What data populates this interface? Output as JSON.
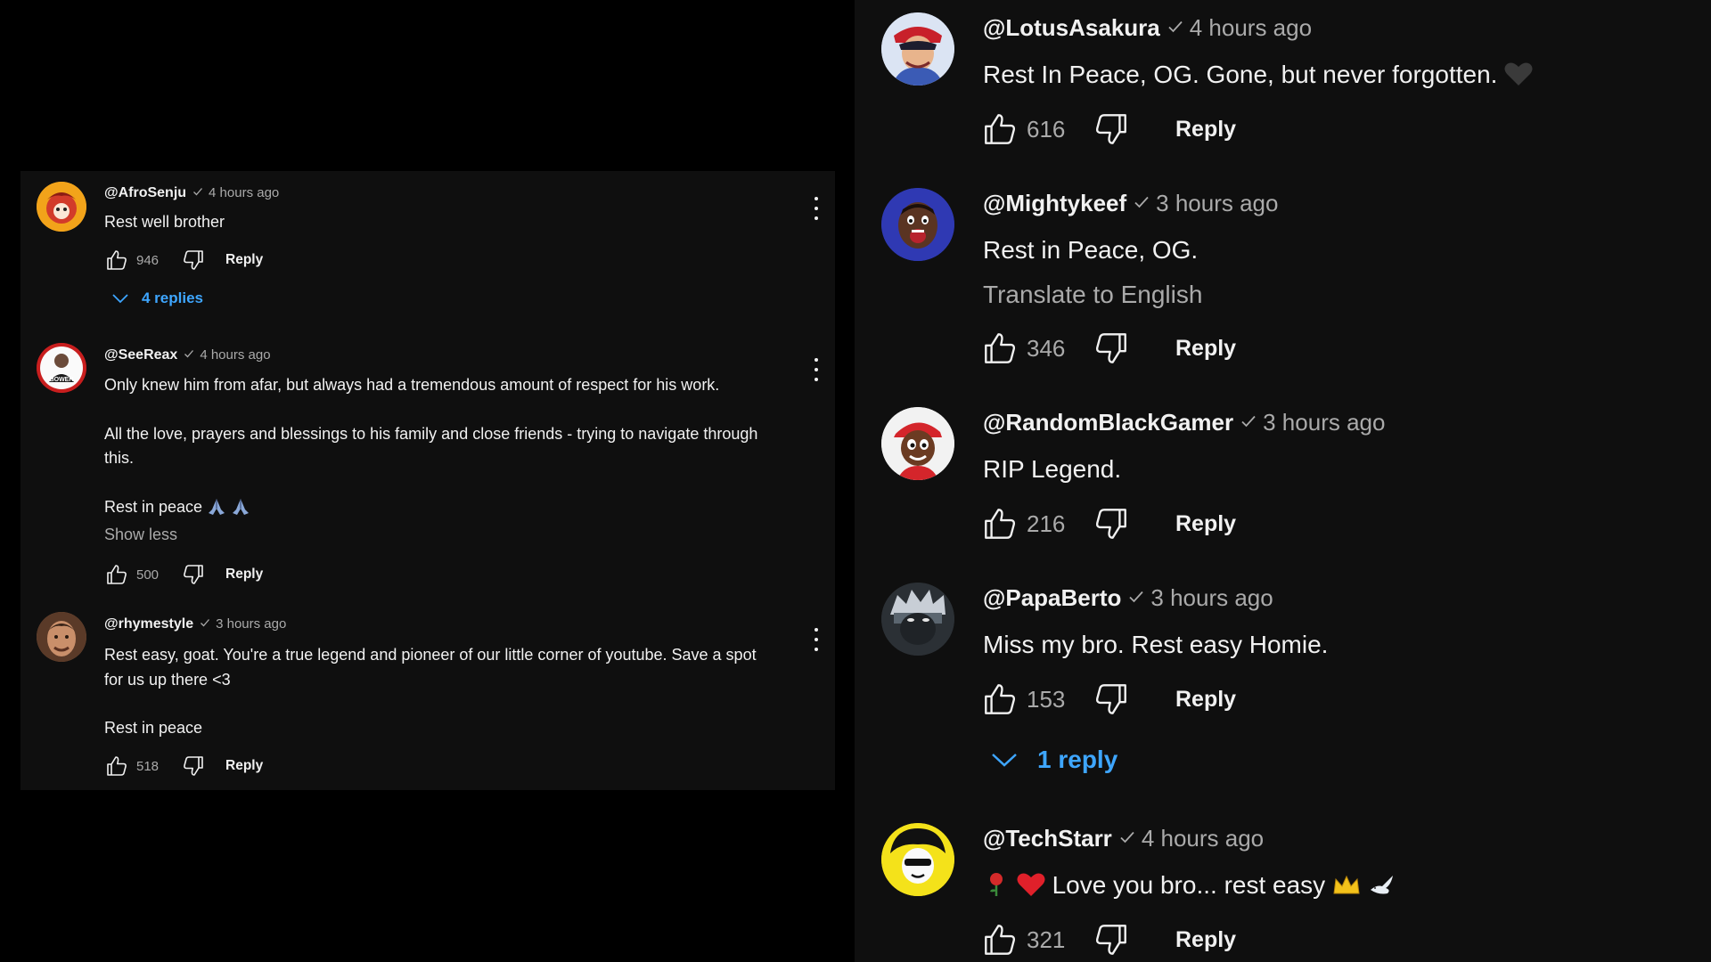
{
  "left_comments": [
    {
      "handle": "@AfroSenju",
      "time": "4 hours ago",
      "lines": [
        "Rest well brother"
      ],
      "likes": "946",
      "reply_label": "Reply",
      "replies_label": "4 replies"
    },
    {
      "handle": "@SeeReax",
      "time": "4 hours ago",
      "paragraphs": [
        "Only knew him from afar, but always had a tremendous amount of respect for his work.",
        "All the love, prayers and blessings to his family and close friends - trying to navigate through this.",
        "Rest in peace"
      ],
      "show_less": "Show less",
      "likes": "500",
      "reply_label": "Reply",
      "avatar_text": "BOWER"
    },
    {
      "handle": "@rhymestyle",
      "time": "3 hours ago",
      "paragraphs": [
        "Rest easy, goat. You're a true legend and pioneer of our little corner of youtube. Save a spot for us up there <3",
        "Rest in peace"
      ],
      "likes": "518",
      "reply_label": "Reply"
    }
  ],
  "right_comments": [
    {
      "handle": "@LotusAsakura",
      "time": "4 hours ago",
      "text": "Rest In Peace, OG. Gone, but never forgotten.",
      "likes": "616",
      "reply_label": "Reply"
    },
    {
      "handle": "@Mightykeef",
      "time": "3 hours ago",
      "text": "Rest in Peace, OG.",
      "translate": "Translate to English",
      "likes": "346",
      "reply_label": "Reply"
    },
    {
      "handle": "@RandomBlackGamer",
      "time": "3 hours ago",
      "text": "RIP Legend.",
      "likes": "216",
      "reply_label": "Reply"
    },
    {
      "handle": "@PapaBerto",
      "time": "3 hours ago",
      "text": "Miss my bro. Rest easy Homie.",
      "likes": "153",
      "reply_label": "Reply",
      "replies_label": "1 reply"
    },
    {
      "handle": "@TechStarr",
      "time": "4 hours ago",
      "text": "Love you bro... rest easy",
      "likes": "321",
      "reply_label": "Reply"
    }
  ],
  "colors": {
    "background": "#000000",
    "panel": "#0f0f0f",
    "text_primary": "#f1f1f1",
    "text_secondary": "#aaaaaa",
    "link_blue": "#3ea6ff"
  }
}
